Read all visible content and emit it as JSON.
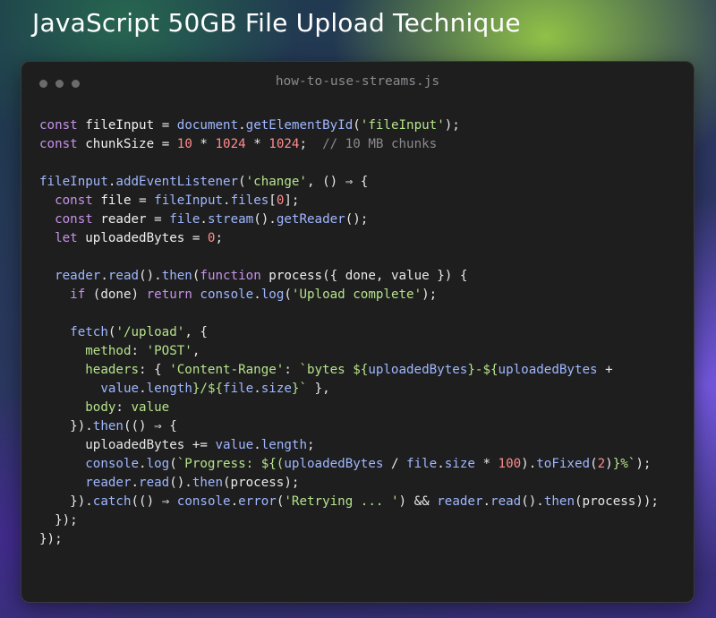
{
  "title": "JavaScript 50GB File Upload Technique",
  "window": {
    "filename": "how-to-use-streams.js"
  },
  "code_lines": [
    [
      [
        "kw",
        "const"
      ],
      [
        "var",
        " fileInput "
      ],
      [
        "op",
        "="
      ],
      [
        "obj",
        " document"
      ],
      [
        "p",
        "."
      ],
      [
        "fn",
        "getElementById"
      ],
      [
        "p",
        "("
      ],
      [
        "str",
        "'fileInput'"
      ],
      [
        "p",
        ");"
      ]
    ],
    [
      [
        "kw",
        "const"
      ],
      [
        "var",
        " chunkSize "
      ],
      [
        "op",
        "="
      ],
      [
        "num",
        " 10"
      ],
      [
        "op",
        " * "
      ],
      [
        "num",
        "1024"
      ],
      [
        "op",
        " * "
      ],
      [
        "num",
        "1024"
      ],
      [
        "p",
        ";"
      ],
      [
        "cm",
        "  // 10 MB chunks"
      ]
    ],
    [],
    [
      [
        "obj",
        "fileInput"
      ],
      [
        "p",
        "."
      ],
      [
        "fn",
        "addEventListener"
      ],
      [
        "p",
        "("
      ],
      [
        "str",
        "'change'"
      ],
      [
        "p",
        ", () "
      ],
      [
        "op",
        "⇒"
      ],
      [
        "p",
        " {"
      ]
    ],
    [
      [
        "p",
        "  "
      ],
      [
        "kw",
        "const"
      ],
      [
        "var",
        " file "
      ],
      [
        "op",
        "="
      ],
      [
        "obj",
        " fileInput"
      ],
      [
        "p",
        "."
      ],
      [
        "prop",
        "files"
      ],
      [
        "p",
        "["
      ],
      [
        "num",
        "0"
      ],
      [
        "p",
        "];"
      ]
    ],
    [
      [
        "p",
        "  "
      ],
      [
        "kw",
        "const"
      ],
      [
        "var",
        " reader "
      ],
      [
        "op",
        "="
      ],
      [
        "obj",
        " file"
      ],
      [
        "p",
        "."
      ],
      [
        "fn",
        "stream"
      ],
      [
        "p",
        "()."
      ],
      [
        "fn",
        "getReader"
      ],
      [
        "p",
        "();"
      ]
    ],
    [
      [
        "p",
        "  "
      ],
      [
        "kw",
        "let"
      ],
      [
        "var",
        " uploadedBytes "
      ],
      [
        "op",
        "="
      ],
      [
        "num",
        " 0"
      ],
      [
        "p",
        ";"
      ]
    ],
    [],
    [
      [
        "p",
        "  "
      ],
      [
        "obj",
        "reader"
      ],
      [
        "p",
        "."
      ],
      [
        "fn",
        "read"
      ],
      [
        "p",
        "()."
      ],
      [
        "fn",
        "then"
      ],
      [
        "p",
        "("
      ],
      [
        "kw",
        "function"
      ],
      [
        "var",
        " process"
      ],
      [
        "p",
        "({ done, value }) {"
      ]
    ],
    [
      [
        "p",
        "    "
      ],
      [
        "kw",
        "if"
      ],
      [
        "p",
        " (done) "
      ],
      [
        "kw",
        "return"
      ],
      [
        "obj",
        " console"
      ],
      [
        "p",
        "."
      ],
      [
        "fn",
        "log"
      ],
      [
        "p",
        "("
      ],
      [
        "str",
        "'Upload complete'"
      ],
      [
        "p",
        ");"
      ]
    ],
    [],
    [
      [
        "p",
        "    "
      ],
      [
        "fn",
        "fetch"
      ],
      [
        "p",
        "("
      ],
      [
        "str",
        "'/upload'"
      ],
      [
        "p",
        ", {"
      ]
    ],
    [
      [
        "p",
        "      "
      ],
      [
        "key",
        "method"
      ],
      [
        "p",
        ": "
      ],
      [
        "str",
        "'POST'"
      ],
      [
        "p",
        ","
      ]
    ],
    [
      [
        "p",
        "      "
      ],
      [
        "key",
        "headers"
      ],
      [
        "p",
        ": { "
      ],
      [
        "str",
        "'Content-Range'"
      ],
      [
        "p",
        ": "
      ],
      [
        "tpl",
        "`bytes ${"
      ],
      [
        "obj",
        "uploadedBytes"
      ],
      [
        "tpl",
        "}-${"
      ],
      [
        "obj",
        "uploadedBytes"
      ],
      [
        "op",
        " +"
      ]
    ],
    [
      [
        "p",
        "        "
      ],
      [
        "obj",
        "value"
      ],
      [
        "p",
        "."
      ],
      [
        "prop",
        "length"
      ],
      [
        "tpl",
        "}/${"
      ],
      [
        "obj",
        "file"
      ],
      [
        "p",
        "."
      ],
      [
        "prop",
        "size"
      ],
      [
        "tpl",
        "}`"
      ],
      [
        "p",
        " },"
      ]
    ],
    [
      [
        "p",
        "      "
      ],
      [
        "key",
        "body"
      ],
      [
        "p",
        ": "
      ],
      [
        "key",
        "value"
      ]
    ],
    [
      [
        "p",
        "    })."
      ],
      [
        "fn",
        "then"
      ],
      [
        "p",
        "(() "
      ],
      [
        "op",
        "⇒"
      ],
      [
        "p",
        " {"
      ]
    ],
    [
      [
        "p",
        "      uploadedBytes "
      ],
      [
        "op",
        "+="
      ],
      [
        "obj",
        " value"
      ],
      [
        "p",
        "."
      ],
      [
        "prop",
        "length"
      ],
      [
        "p",
        ";"
      ]
    ],
    [
      [
        "p",
        "      "
      ],
      [
        "obj",
        "console"
      ],
      [
        "p",
        "."
      ],
      [
        "fn",
        "log"
      ],
      [
        "p",
        "("
      ],
      [
        "tpl",
        "`Progress: ${("
      ],
      [
        "obj",
        "uploadedBytes"
      ],
      [
        "op",
        " / "
      ],
      [
        "obj",
        "file"
      ],
      [
        "p",
        "."
      ],
      [
        "prop",
        "size"
      ],
      [
        "op",
        " * "
      ],
      [
        "num",
        "100"
      ],
      [
        "p",
        ")."
      ],
      [
        "fn",
        "toFixed"
      ],
      [
        "p",
        "("
      ],
      [
        "num",
        "2"
      ],
      [
        "p",
        ")"
      ],
      [
        "tpl",
        "}%`"
      ],
      [
        "p",
        ");"
      ]
    ],
    [
      [
        "p",
        "      "
      ],
      [
        "obj",
        "reader"
      ],
      [
        "p",
        "."
      ],
      [
        "fn",
        "read"
      ],
      [
        "p",
        "()."
      ],
      [
        "fn",
        "then"
      ],
      [
        "p",
        "(process);"
      ]
    ],
    [
      [
        "p",
        "    })."
      ],
      [
        "fn",
        "catch"
      ],
      [
        "p",
        "(() "
      ],
      [
        "op",
        "⇒"
      ],
      [
        "obj",
        " console"
      ],
      [
        "p",
        "."
      ],
      [
        "fn",
        "error"
      ],
      [
        "p",
        "("
      ],
      [
        "str",
        "'Retrying ... '"
      ],
      [
        "p",
        ") && "
      ],
      [
        "obj",
        "reader"
      ],
      [
        "p",
        "."
      ],
      [
        "fn",
        "read"
      ],
      [
        "p",
        "()."
      ],
      [
        "fn",
        "then"
      ],
      [
        "p",
        "(process));"
      ]
    ],
    [
      [
        "p",
        "  });"
      ]
    ],
    [
      [
        "p",
        "});"
      ]
    ]
  ]
}
